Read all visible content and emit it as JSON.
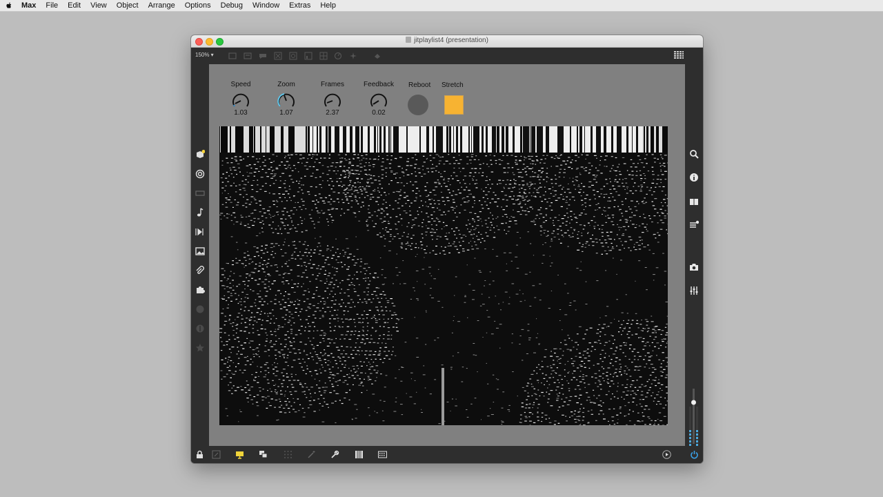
{
  "menubar": {
    "app_name": "Max",
    "items": [
      "File",
      "Edit",
      "View",
      "Object",
      "Arrange",
      "Options",
      "Debug",
      "Window",
      "Extras",
      "Help"
    ]
  },
  "window": {
    "title": "jitplaylist4 (presentation)"
  },
  "toolbar": {
    "zoom": "150% ▾"
  },
  "controls": {
    "speed": {
      "label": "Speed",
      "value": "1.03"
    },
    "zoom": {
      "label": "Zoom",
      "value": "1.07"
    },
    "frames": {
      "label": "Frames",
      "value": "2.37"
    },
    "feedback": {
      "label": "Feedback",
      "value": "0.02"
    },
    "reboot": {
      "label": "Reboot"
    },
    "stretch": {
      "label": "Stretch",
      "color": "#f7b332"
    }
  },
  "icons": {
    "left": [
      "cube-icon",
      "target-icon",
      "monitor-icon",
      "music-note-icon",
      "play-step-icon",
      "image-icon",
      "paperclip-icon",
      "puzzle-icon",
      "circle-icon",
      "half-circle-icon",
      "star-icon"
    ],
    "right": [
      "search-icon",
      "info-icon",
      "book-icon",
      "list-icon",
      "camera-icon",
      "mixer-icon"
    ],
    "bottom": [
      "lock-icon",
      "edit-icon",
      "presentation-icon",
      "windows-icon",
      "grid-dots-icon",
      "wand-icon",
      "wrench-icon",
      "piano-icon",
      "keyboard-icon",
      "play-icon",
      "power-icon"
    ]
  },
  "colors": {
    "window_bg": "#2e2e2e",
    "canvas_bg": "#808080",
    "accent": "#f7b332",
    "power": "#3aa0e6"
  }
}
